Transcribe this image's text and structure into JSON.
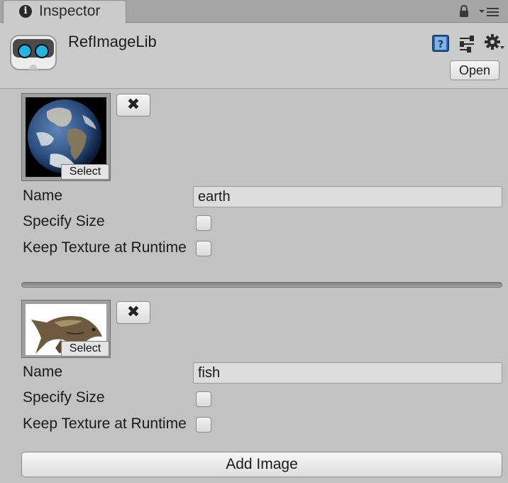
{
  "tab": {
    "label": "Inspector",
    "icon": "info-icon"
  },
  "window_icons": [
    "lock-icon",
    "menu-icon"
  ],
  "header": {
    "title": "RefImageLib",
    "icon": "cardboard-viewer-icon",
    "actions": [
      "help-icon",
      "sliders-icon",
      "gear-icon"
    ],
    "open_label": "Open"
  },
  "images": [
    {
      "thumbnail": "earth-globe-image",
      "select_label": "Select",
      "remove_label": "✖",
      "name_label": "Name",
      "name_value": "earth",
      "specify_size_label": "Specify Size",
      "specify_size_checked": false,
      "keep_texture_label": "Keep Texture at Runtime",
      "keep_texture_checked": false
    },
    {
      "thumbnail": "fish-image",
      "select_label": "Select",
      "remove_label": "✖",
      "name_label": "Name",
      "name_value": "fish",
      "specify_size_label": "Specify Size",
      "specify_size_checked": false,
      "keep_texture_label": "Keep Texture at Runtime",
      "keep_texture_checked": false
    }
  ],
  "add_image_label": "Add Image",
  "colors": {
    "panel_bg": "#c2c2c2",
    "header_bg": "#cbcbcb",
    "tabbar_bg": "#a5a5a5",
    "field_bg": "#dcdcdc"
  }
}
